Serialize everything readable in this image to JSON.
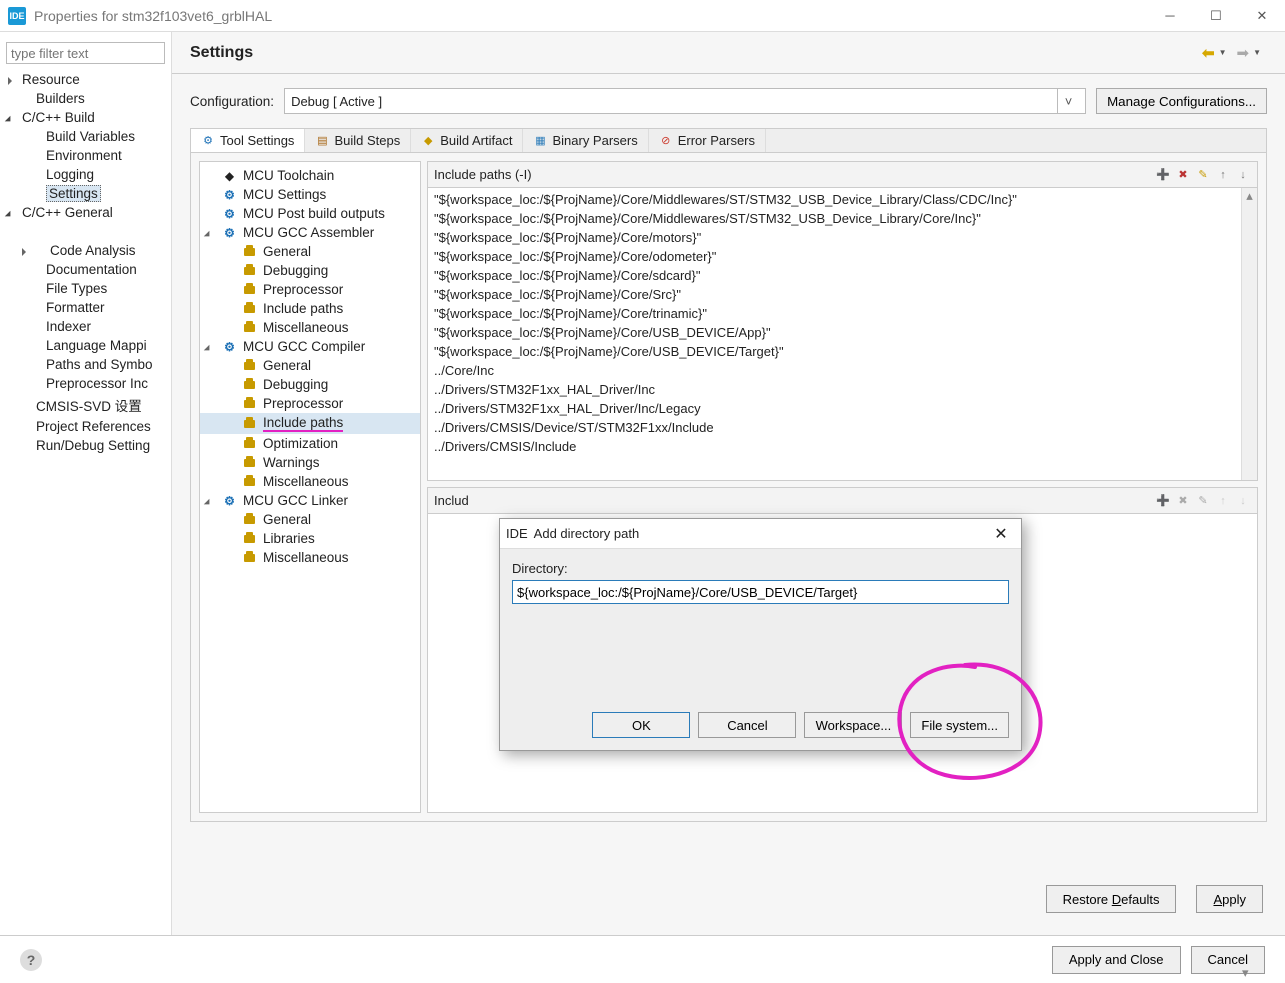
{
  "window": {
    "title": "Properties for stm32f103vet6_grblHAL"
  },
  "filter": {
    "placeholder": "type filter text"
  },
  "leftTree": {
    "resource": "Resource",
    "builders": "Builders",
    "ccbuild": "C/C++ Build",
    "buildVars": "Build Variables",
    "environment": "Environment",
    "logging": "Logging",
    "settings": "Settings",
    "ccgeneral": "C/C++ General",
    "codeAnalysis": "Code Analysis",
    "documentation": "Documentation",
    "fileTypes": "File Types",
    "formatter": "Formatter",
    "indexer": "Indexer",
    "langMap": "Language Mappi",
    "pathsSymbols": "Paths and Symbo",
    "preprocInc": "Preprocessor Inc",
    "cmsis": "CMSIS-SVD 设置",
    "projRefs": "Project References",
    "runDebug": "Run/Debug Setting"
  },
  "page": {
    "title": "Settings",
    "configLabel": "Configuration:",
    "configValue": "Debug  [ Active ]",
    "manageBtn": "Manage Configurations..."
  },
  "tabs": {
    "toolSettings": "Tool Settings",
    "buildSteps": "Build Steps",
    "buildArtifact": "Build Artifact",
    "binaryParsers": "Binary Parsers",
    "errorParsers": "Error Parsers"
  },
  "toolTree": {
    "mcuToolchain": "MCU Toolchain",
    "mcuSettings": "MCU Settings",
    "mcuPostBuild": "MCU Post build outputs",
    "gccAssembler": "MCU GCC Assembler",
    "general": "General",
    "debugging": "Debugging",
    "preprocessor": "Preprocessor",
    "includePaths": "Include paths",
    "misc": "Miscellaneous",
    "gccCompiler": "MCU GCC Compiler",
    "optimization": "Optimization",
    "warnings": "Warnings",
    "gccLinker": "MCU GCC Linker",
    "libraries": "Libraries"
  },
  "pane1": {
    "title": "Include paths (-I)",
    "items": [
      "\"${workspace_loc:/${ProjName}/Core/Middlewares/ST/STM32_USB_Device_Library/Class/CDC/Inc}\"",
      "\"${workspace_loc:/${ProjName}/Core/Middlewares/ST/STM32_USB_Device_Library/Core/Inc}\"",
      "\"${workspace_loc:/${ProjName}/Core/motors}\"",
      "\"${workspace_loc:/${ProjName}/Core/odometer}\"",
      "\"${workspace_loc:/${ProjName}/Core/sdcard}\"",
      "\"${workspace_loc:/${ProjName}/Core/Src}\"",
      "\"${workspace_loc:/${ProjName}/Core/trinamic}\"",
      "\"${workspace_loc:/${ProjName}/Core/USB_DEVICE/App}\"",
      "\"${workspace_loc:/${ProjName}/Core/USB_DEVICE/Target}\"",
      "../Core/Inc",
      "../Drivers/STM32F1xx_HAL_Driver/Inc",
      "../Drivers/STM32F1xx_HAL_Driver/Inc/Legacy",
      "../Drivers/CMSIS/Device/ST/STM32F1xx/Include",
      "../Drivers/CMSIS/Include"
    ]
  },
  "pane2": {
    "title": "Includ"
  },
  "dialog": {
    "title": "Add directory path",
    "label": "Directory:",
    "value": "${workspace_loc:/${ProjName}/Core/USB_DEVICE/Target}",
    "ok": "OK",
    "cancel": "Cancel",
    "workspace": "Workspace...",
    "filesystem": "File system..."
  },
  "footer": {
    "restore": "Restore Defaults",
    "apply": "Apply",
    "applyClose": "Apply and Close",
    "cancel": "Cancel"
  }
}
